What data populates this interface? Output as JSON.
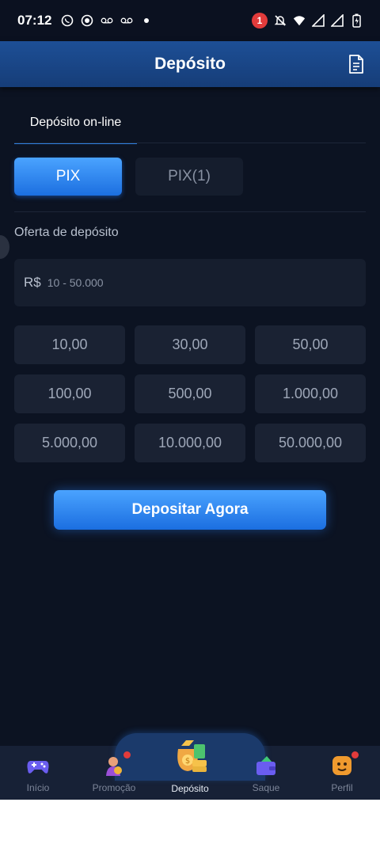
{
  "status_bar": {
    "time": "07:12",
    "notification_count": "1"
  },
  "header": {
    "title": "Depósito"
  },
  "tabs": {
    "online": "Depósito on-line"
  },
  "methods": [
    "PIX",
    "PIX(1)"
  ],
  "offer": {
    "label": "Oferta de depósito",
    "currency": "R$",
    "placeholder": "10 - 50.000"
  },
  "amounts": [
    "10,00",
    "30,00",
    "50,00",
    "100,00",
    "500,00",
    "1.000,00",
    "5.000,00",
    "10.000,00",
    "50.000,00"
  ],
  "cta": {
    "label": "Depositar Agora"
  },
  "nav": {
    "inicio": "Início",
    "promocao": "Promoção",
    "deposito": "Depósito",
    "saque": "Saque",
    "perfil": "Perfil"
  },
  "colors": {
    "accent": "#2f7fe0",
    "background": "#0c1322",
    "header": "#1d4f96",
    "badge": "#e23b3b"
  }
}
